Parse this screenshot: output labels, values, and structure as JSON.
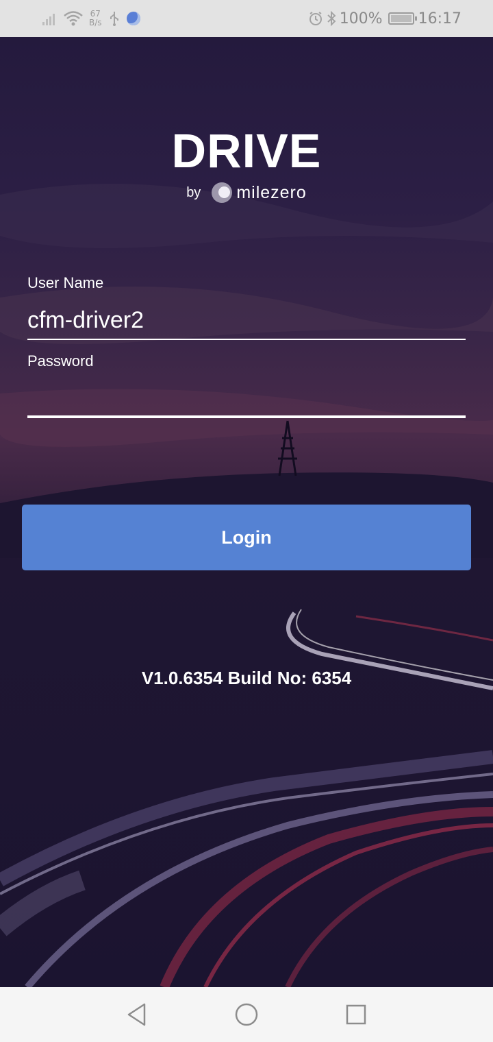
{
  "status_bar": {
    "net_speed_value": "67",
    "net_speed_unit": "B/s",
    "battery_percent": "100%",
    "time": "16:17",
    "icons": [
      "signal-icon",
      "wifi-icon",
      "usb-icon",
      "vpn-icon",
      "alarm-icon",
      "bluetooth-icon",
      "battery-icon"
    ]
  },
  "brand": {
    "title": "DRIVE",
    "by": "by",
    "company": "milezero"
  },
  "form": {
    "username_label": "User Name",
    "username_value": "cfm-driver2",
    "password_label": "Password",
    "password_value": ""
  },
  "login_label": "Login",
  "version": "V1.0.6354 Build No: 6354",
  "colors": {
    "button": "#5582d3",
    "background": "#1d1433",
    "status_bar": "#e3e3e3",
    "nav_bar": "#f5f5f5"
  },
  "nav": {
    "icons": [
      "back-icon",
      "home-icon",
      "recents-icon"
    ]
  }
}
